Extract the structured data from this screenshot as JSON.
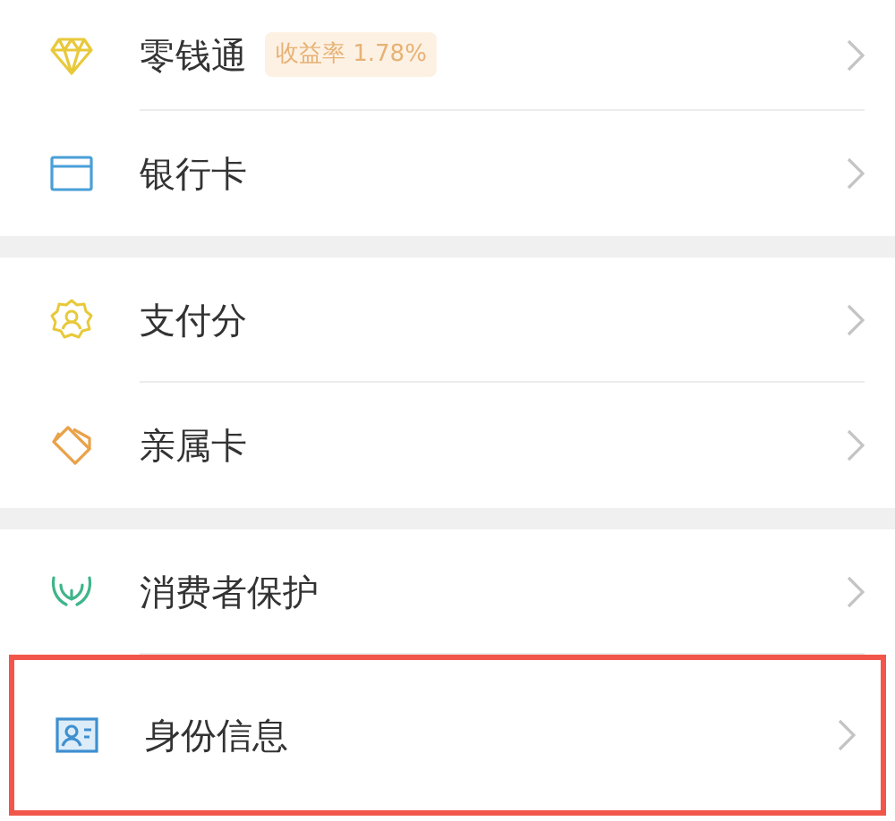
{
  "sections": [
    {
      "items": [
        {
          "kind": "diamond",
          "label": "零钱通",
          "badge": "收益率 1.78%",
          "highlighted": false
        },
        {
          "kind": "card",
          "label": "银行卡",
          "highlighted": false
        }
      ]
    },
    {
      "items": [
        {
          "kind": "badge",
          "label": "支付分",
          "highlighted": false
        },
        {
          "kind": "cards",
          "label": "亲属卡",
          "highlighted": false
        }
      ]
    },
    {
      "items": [
        {
          "kind": "hands",
          "label": "消费者保护",
          "highlighted": false
        },
        {
          "kind": "id",
          "label": "身份信息",
          "highlighted": true
        }
      ]
    }
  ]
}
